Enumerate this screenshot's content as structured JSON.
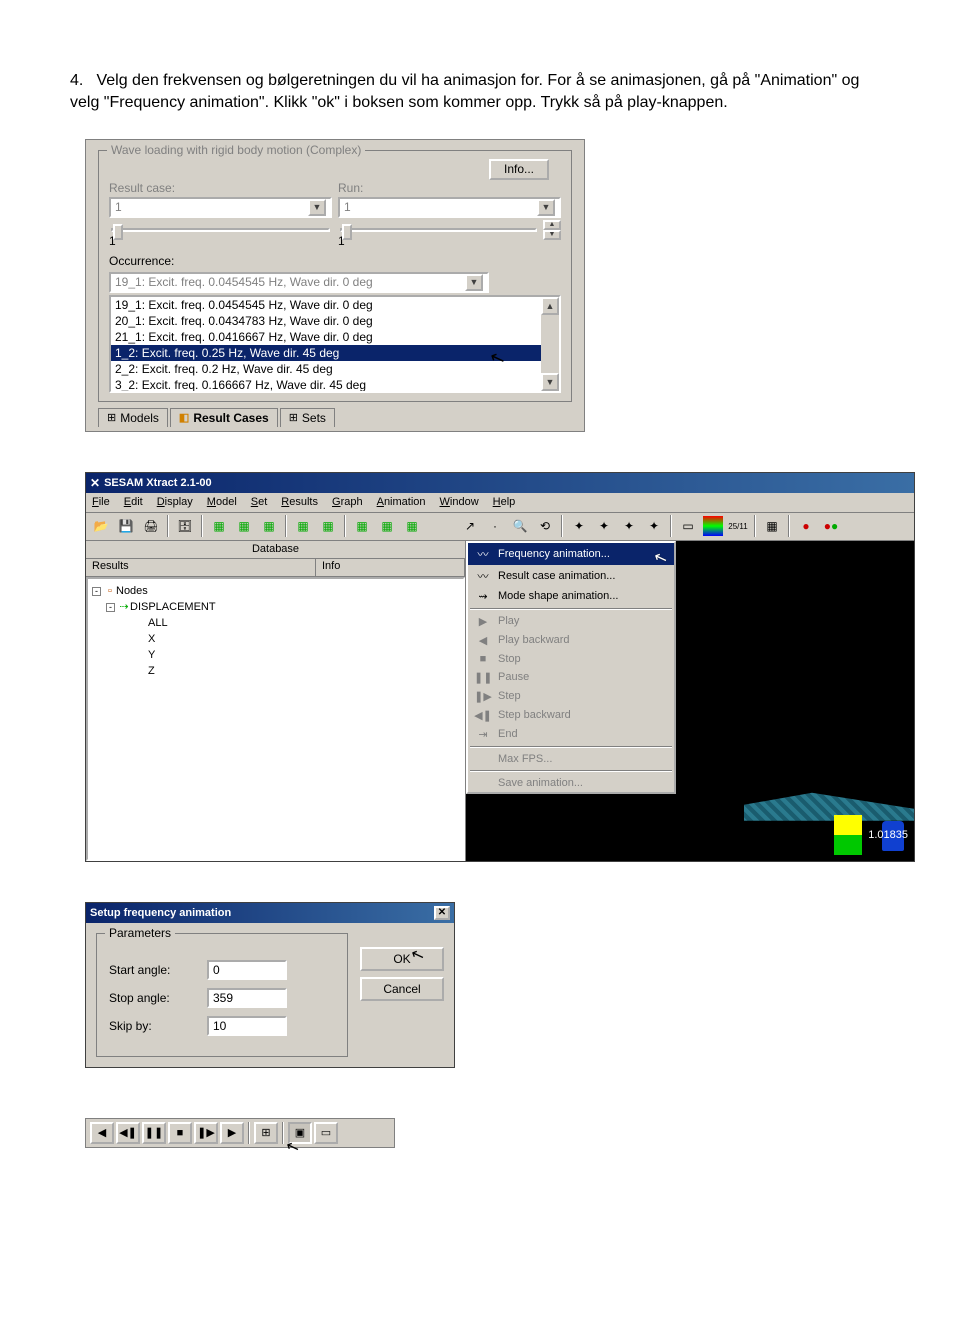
{
  "instruction": {
    "num": "4.",
    "text": "Velg den frekvensen og bølgeretningen du vil ha animasjon for. For å se animasjonen, gå på \"Animation\" og velg \"Frequency animation\". Klikk \"ok\" i boksen som kommer opp. Trykk så på play-knappen."
  },
  "panel1": {
    "group_title": "Wave loading with rigid body motion (Complex)",
    "info_btn": "Info...",
    "result_case_label": "Result case:",
    "run_label": "Run:",
    "result_case_value": "1",
    "run_value": "1",
    "small_one_left": "1",
    "small_one_right": "1",
    "occurrence_label": "Occurrence:",
    "occurrence_value": "19_1: Excit. freq. 0.0454545 Hz, Wave dir. 0 deg",
    "list": [
      "19_1: Excit. freq. 0.0454545 Hz, Wave dir. 0 deg",
      "20_1: Excit. freq. 0.0434783 Hz, Wave dir. 0 deg",
      "21_1: Excit. freq. 0.0416667 Hz, Wave dir. 0 deg",
      "1_2: Excit. freq. 0.25 Hz, Wave dir. 45 deg",
      "2_2: Excit. freq. 0.2 Hz, Wave dir. 45 deg",
      "3_2: Excit. freq. 0.166667 Hz, Wave dir. 45 deg"
    ],
    "selected_index": 3,
    "tabs": {
      "models": "Models",
      "result_cases": "Result Cases",
      "sets": "Sets"
    }
  },
  "app": {
    "title": "SESAM Xtract 2.1-00",
    "menu": {
      "file": "File",
      "edit": "Edit",
      "display": "Display",
      "model": "Model",
      "set": "Set",
      "results": "Results",
      "graph": "Graph",
      "animation": "Animation",
      "window": "Window",
      "help": "Help"
    },
    "db_label": "Database",
    "cols": {
      "results": "Results",
      "info": "Info"
    },
    "tree": {
      "nodes": "Nodes",
      "displacement": "DISPLACEMENT",
      "all": "ALL",
      "x": "X",
      "y": "Y",
      "z": "Z"
    },
    "dropdown": {
      "freq": "Frequency animation...",
      "resultcase": "Result case animation...",
      "modeshape": "Mode shape animation...",
      "play": "Play",
      "playback": "Play backward",
      "stop": "Stop",
      "pause": "Pause",
      "step": "Step",
      "stepback": "Step backward",
      "end": "End",
      "maxfps": "Max FPS...",
      "save": "Save animation..."
    },
    "legend_value": "1.01835"
  },
  "dialog": {
    "title": "Setup frequency animation",
    "params_label": "Parameters",
    "start_angle_label": "Start angle:",
    "start_angle_value": "0",
    "stop_angle_label": "Stop angle:",
    "stop_angle_value": "359",
    "skip_by_label": "Skip by:",
    "skip_by_value": "10",
    "ok": "OK",
    "cancel": "Cancel"
  }
}
